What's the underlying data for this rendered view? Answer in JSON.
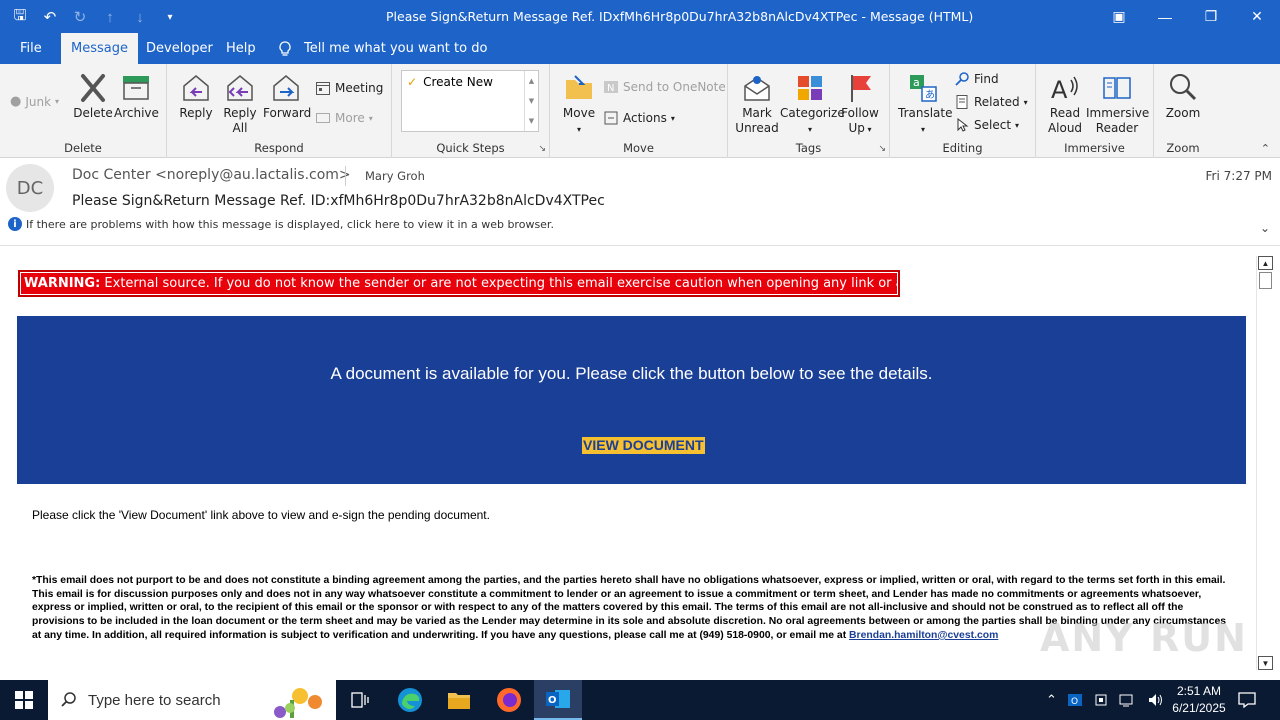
{
  "window": {
    "title": "Please Sign&Return Message Ref. IDxfMh6Hr8p0Du7hrA32b8nAlcDv4XTPec  -  Message (HTML)"
  },
  "menu": {
    "tabs": [
      "File",
      "Message",
      "Developer",
      "Help"
    ],
    "active_tab": "Message",
    "tell_me": "Tell me what you want to do"
  },
  "ribbon": {
    "delete_group": {
      "label": "Delete",
      "junk": "Junk",
      "delete": "Delete",
      "archive": "Archive"
    },
    "respond_group": {
      "label": "Respond",
      "reply": "Reply",
      "reply_all_1": "Reply",
      "reply_all_2": "All",
      "forward": "Forward",
      "meeting": "Meeting",
      "more": "More"
    },
    "quick_steps": {
      "label": "Quick Steps",
      "create_new": "Create New"
    },
    "move_group": {
      "label": "Move",
      "move": "Move",
      "onenote": "Send to OneNote",
      "actions": "Actions"
    },
    "tags_group": {
      "label": "Tags",
      "mark_unread_1": "Mark",
      "mark_unread_2": "Unread",
      "categorize": "Categorize",
      "follow_up_1": "Follow",
      "follow_up_2": "Up"
    },
    "editing_group": {
      "label": "Editing",
      "translate": "Translate",
      "find": "Find",
      "related": "Related",
      "select": "Select"
    },
    "immersive_group": {
      "label": "Immersive",
      "read_aloud_1": "Read",
      "read_aloud_2": "Aloud",
      "immersive_reader_1": "Immersive",
      "immersive_reader_2": "Reader"
    },
    "zoom_group": {
      "label": "Zoom",
      "zoom": "Zoom"
    }
  },
  "message": {
    "avatar_initials": "DC",
    "from": "Doc Center <noreply@au.lactalis.com>",
    "to": "Mary Groh",
    "date": "Fri 7:27 PM",
    "subject": "Please Sign&Return Message Ref. ID:xfMh6Hr8p0Du7hrA32b8nAlcDv4XTPec",
    "info_bar": "If there are problems with how this message is displayed, click here to view it in a web browser."
  },
  "body": {
    "warning_label": "WARNING:",
    "warning_text": " External source. If you do not know the sender or are not expecting this email exercise caution when opening any link or attachments.",
    "banner_text": "A document is available for you. Please click the button below to see the details.",
    "view_button": "VIEW DOCUMENT",
    "instruction": "Please click the 'View Document' link above to view and e-sign the pending document.",
    "disclaimer": "*This email does not purport to be and does not constitute a binding agreement among the parties, and the parties hereto shall have no obligations whatsoever, express or implied, written or oral, with regard to the terms set forth in this email. This email is for discussion purposes only and does not in any way whatsoever constitute a commitment to lender or an agreement to issue a commitment or term sheet, and Lender has made no commitments or agreements whatsoever, express or implied, written or oral, to the recipient of this email or the sponsor or with respect to any of the matters covered by this email. The terms of this email are not all-inclusive and should not be construed as to reflect all off the provisions to be included in the loan document or the term sheet and may be varied as the Lender may determine in its sole and absolute discretion. No oral agreements between or among the parties shall be binding under any circumstances at any time. In addition, all required information is subject to verification and underwriting. If you have any questions, please call me at (949) 518-0900, or email me at ",
    "email_link": "Brendan.hamilton@cvest.com",
    "watermark": "ANY RUN"
  },
  "taskbar": {
    "search_placeholder": "Type here to search",
    "time": "2:51 AM",
    "date": "6/21/2025"
  },
  "colors": {
    "accent": "#1e64c8",
    "banner": "#1a3f96",
    "warning": "#e8000b",
    "button": "#f7c030"
  }
}
